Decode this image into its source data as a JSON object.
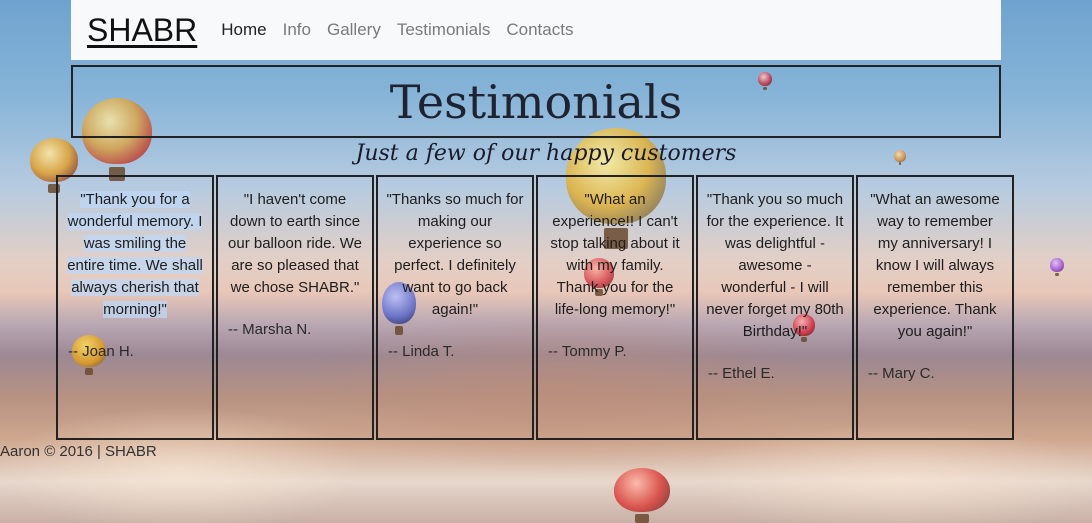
{
  "nav": {
    "brand": "SHABR",
    "links": [
      "Home",
      "Info",
      "Gallery",
      "Testimonials",
      "Contacts"
    ],
    "active": "Home"
  },
  "header": {
    "title": "Testimonials",
    "subtitle": "Just a few of our happy customers"
  },
  "testimonials": [
    {
      "quote": "\"Thank you for a wonderful memory. I was smiling the entire time. We shall always cherish that morning!\"",
      "author": "-- Joan H."
    },
    {
      "quote": "\"I haven't come down to earth since our balloon ride. We are so pleased that we chose SHABR.\"",
      "author": "-- Marsha N."
    },
    {
      "quote": "\"Thanks so much for making our experience so perfect. I definitely want to go back again!\"",
      "author": "-- Linda T."
    },
    {
      "quote": "\"What an experience!! I can't stop talking about it with my family. Thank you for the life-long memory!\"",
      "author": "-- Tommy P."
    },
    {
      "quote": "\"Thank you so much for the experience. It was delightful - awesome - wonderful - I will never forget my 80th Birthday!\"",
      "author": "-- Ethel E."
    },
    {
      "quote": "\"What an awesome way to remember my anniversary! I know I will always remember this experience. Thank you again!\"",
      "author": "-- Mary C."
    }
  ],
  "footer": {
    "text": "Aaron © 2016 | SHABR"
  },
  "colors": {
    "navbar_bg": "#f8f9fa",
    "border": "#222222",
    "title": "#1f2230"
  }
}
